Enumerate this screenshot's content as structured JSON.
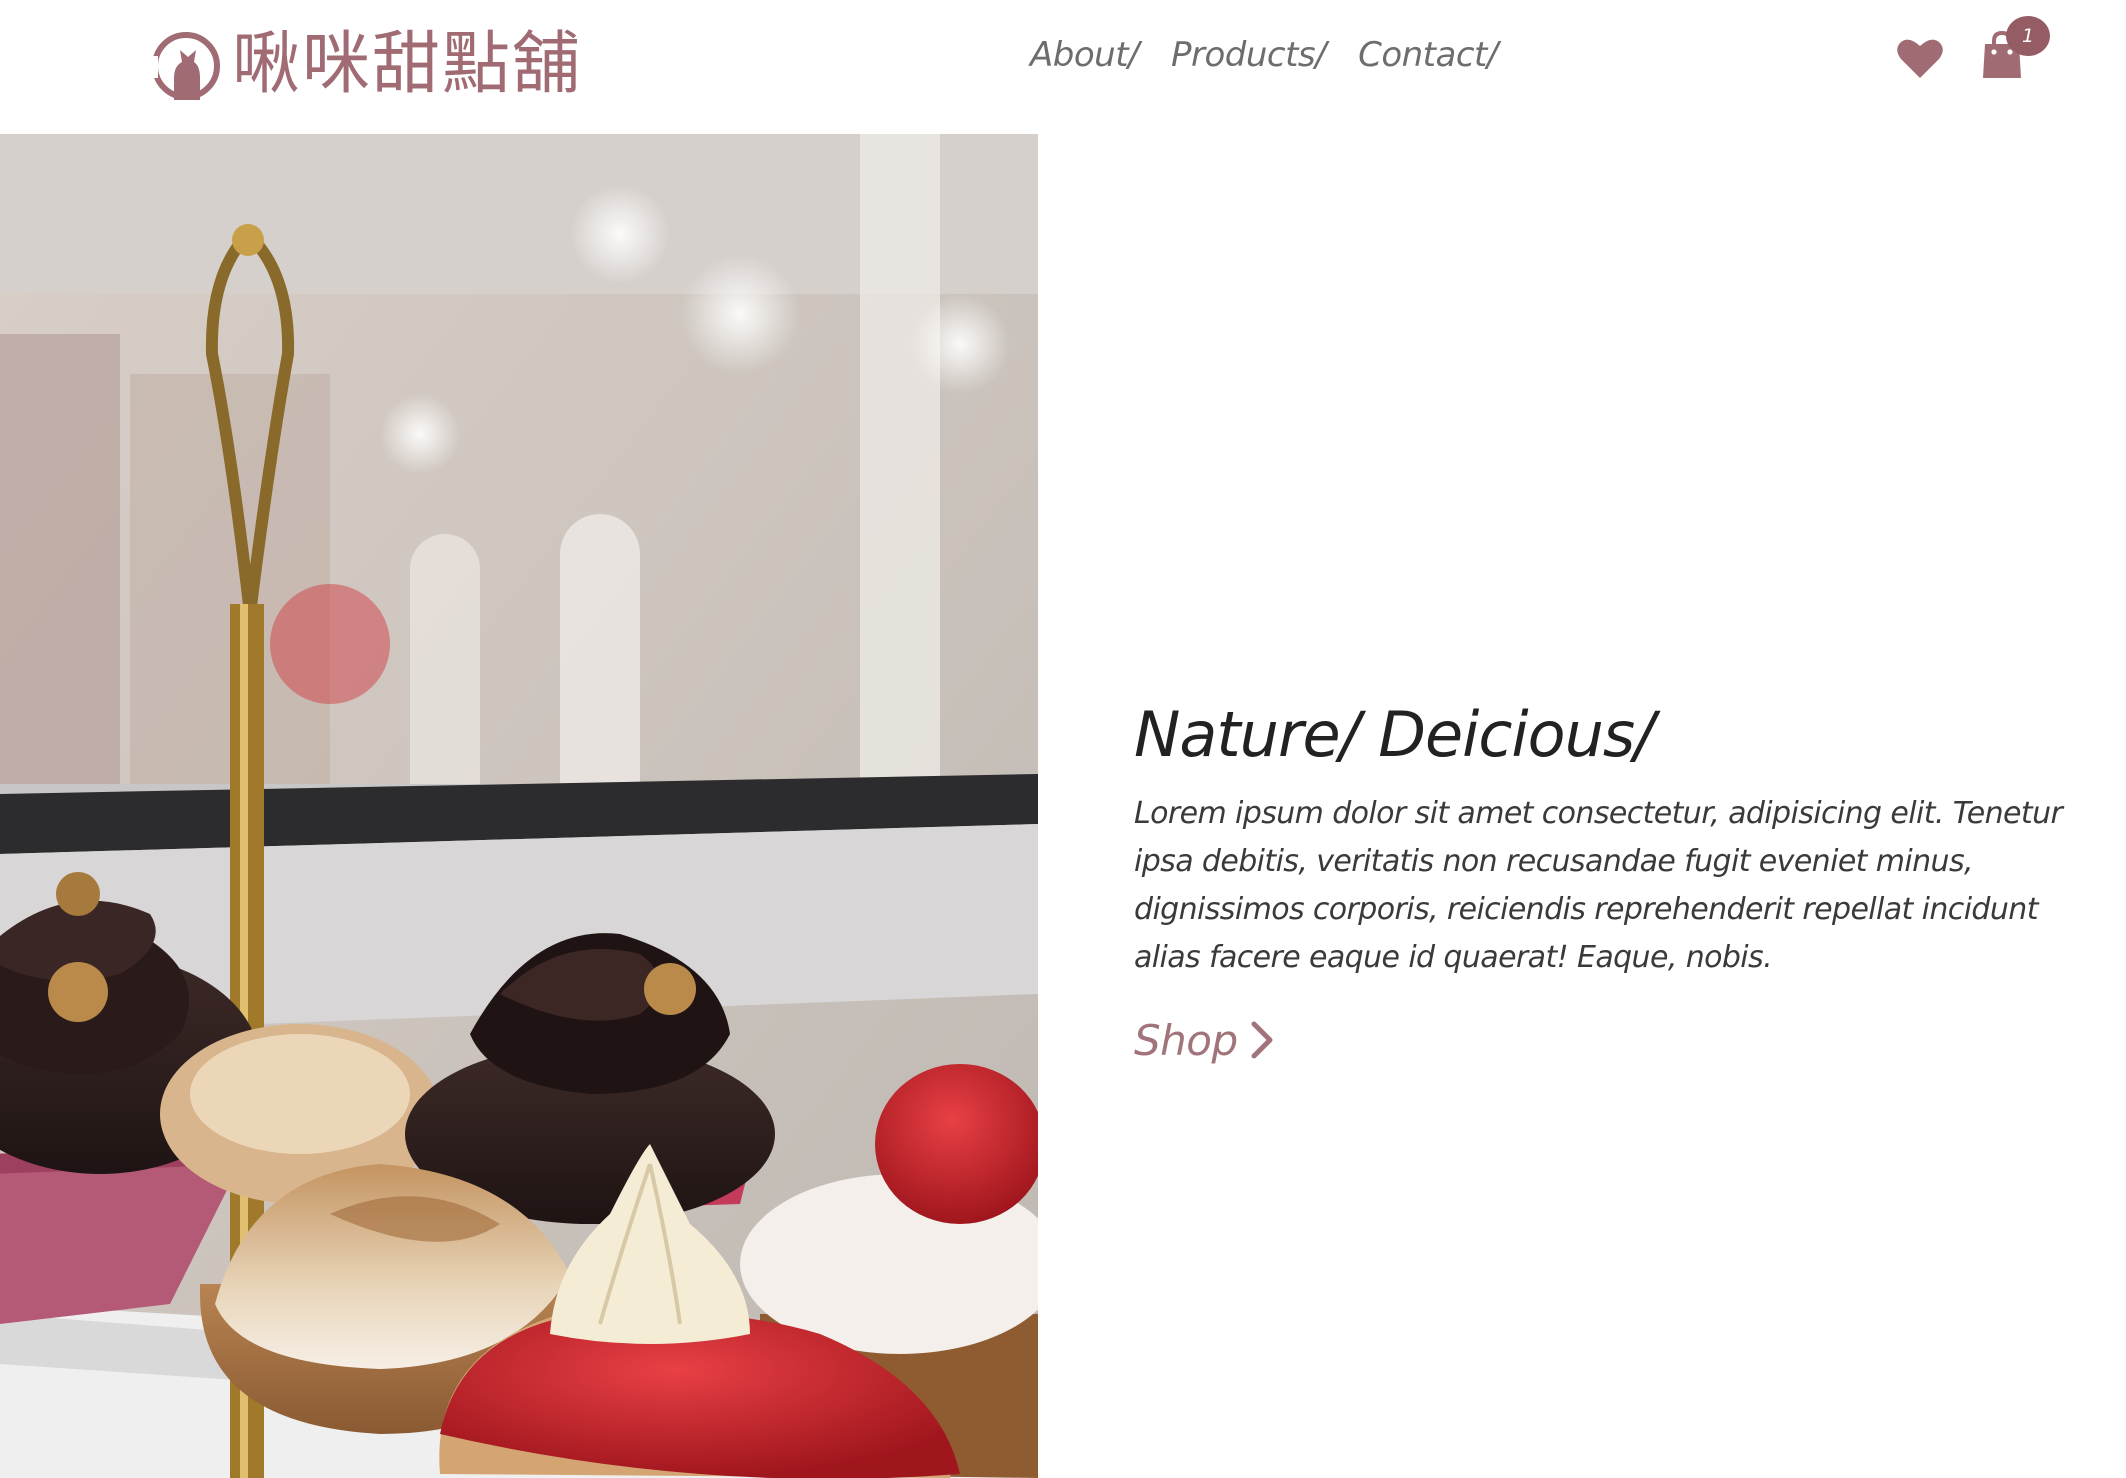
{
  "brand": {
    "name": "啾咪甜點舖",
    "accent_color": "#a06b73",
    "logo_icon": "cat-circle-icon"
  },
  "nav": {
    "items": [
      {
        "label": "About/"
      },
      {
        "label": "Products/"
      },
      {
        "label": "Contact/"
      }
    ]
  },
  "header_actions": {
    "wishlist_icon": "heart-icon",
    "cart_icon": "shopping-bag-icon",
    "cart_count": "1"
  },
  "hero": {
    "image_icon": "cupcakes-photo",
    "title": "Nature/ Deicious/",
    "description": "Lorem ipsum dolor sit amet consectetur, adipisicing elit. Tenetur ipsa debitis, veritatis non recusandae fugit eveniet minus, dignissimos corporis, reiciendis reprehenderit repellat incidunt alias facere eaque id quaerat! Eaque, nobis.",
    "cta_label": "Shop",
    "cta_icon": "chevron-right-icon"
  }
}
